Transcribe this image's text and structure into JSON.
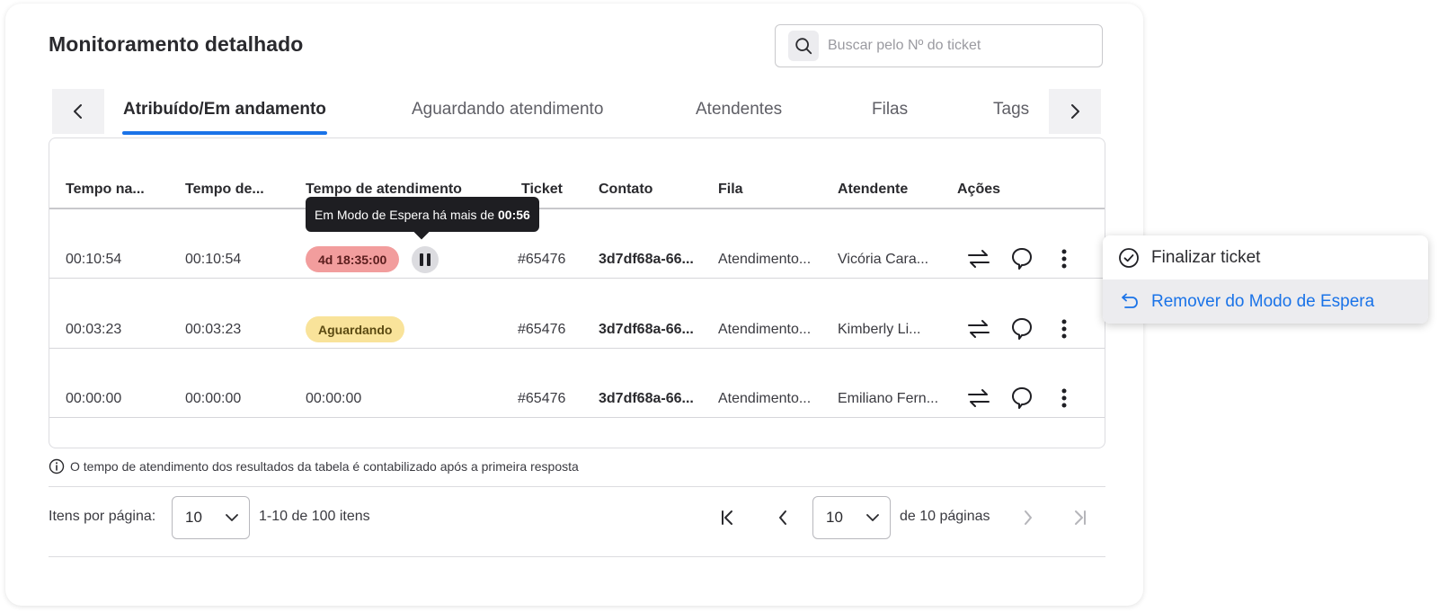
{
  "page": {
    "title": "Monitoramento detalhado"
  },
  "search": {
    "placeholder": "Buscar pelo Nº do ticket"
  },
  "tabs": [
    {
      "label": "Atribuído/Em andamento",
      "active": true
    },
    {
      "label": "Aguardando atendimento",
      "active": false
    },
    {
      "label": "Atendentes",
      "active": false
    },
    {
      "label": "Filas",
      "active": false
    },
    {
      "label": "Tags",
      "active": false
    }
  ],
  "table": {
    "headers": [
      "Tempo na...",
      "Tempo de...",
      "Tempo de atendimento",
      "Ticket",
      "Contato",
      "Fila",
      "Atendente",
      "Ações"
    ],
    "rows": [
      {
        "tempo_na": "00:10:54",
        "tempo_de": "00:10:54",
        "atendimento": "4d 18:35:00",
        "ticket": "#65476",
        "contato": "3d7df68a-66...",
        "fila": "Atendimento...",
        "atendente": "Vicória Cara..."
      },
      {
        "tempo_na": "00:03:23",
        "tempo_de": "00:03:23",
        "atendimento": "Aguardando",
        "ticket": "#65476",
        "contato": "3d7df68a-66...",
        "fila": "Atendimento...",
        "atendente": "Kimberly Li..."
      },
      {
        "tempo_na": "00:00:00",
        "tempo_de": "00:00:00",
        "atendimento": "00:00:00",
        "ticket": "#65476",
        "contato": "3d7df68a-66...",
        "fila": "Atendimento...",
        "atendente": "Emiliano Fern..."
      }
    ]
  },
  "tooltip": {
    "text": "Em Modo de Espera há mais de",
    "time": "00:56"
  },
  "note": "O tempo de atendimento dos resultados da tabela é contabilizado após a primeira resposta",
  "pagination": {
    "per_page_label": "Itens por página:",
    "per_page_value": "10",
    "range_text": "1-10 de 100 itens",
    "page_value": "10",
    "pages_text": "de 10 páginas"
  },
  "menu": {
    "items": [
      {
        "label": "Finalizar ticket",
        "icon": "check-circle-icon"
      },
      {
        "label": "Remover do Modo de Espera",
        "icon": "undo-arrow-icon"
      }
    ]
  },
  "colors": {
    "accent": "#1a73e8",
    "pill_red": "#f29d9d",
    "pill_yellow": "#f9e39a",
    "tooltip_bg": "#1e1e22"
  }
}
